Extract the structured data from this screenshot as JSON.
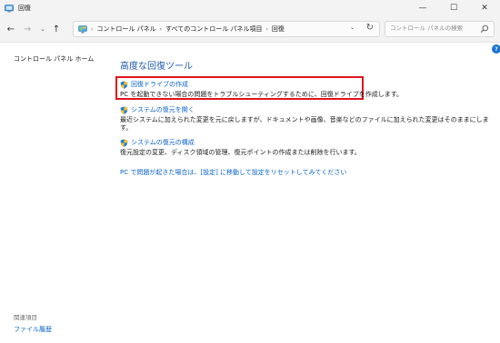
{
  "window": {
    "title": "回復",
    "minimize_glyph": "—",
    "maximize_glyph": "☐",
    "close_glyph": "✕"
  },
  "nav": {
    "back_glyph": "←",
    "forward_glyph": "→",
    "history_glyph": "⌄",
    "up_glyph": "↑",
    "refresh_glyph": "↻",
    "dropdown_glyph": "⌄"
  },
  "address": {
    "separator": "›",
    "breadcrumbs": [
      "コントロール パネル",
      "すべてのコントロール パネル項目",
      "回復"
    ]
  },
  "search": {
    "placeholder": "コントロール パネルの検索"
  },
  "help": {
    "label": "?"
  },
  "sidebar": {
    "home_label": "コントロール パネル ホーム",
    "related_heading": "関連項目",
    "related_links": [
      "ファイル履歴"
    ]
  },
  "main": {
    "title": "高度な回復ツール",
    "tasks": [
      {
        "link": "回復ドライブの作成",
        "description": "PC を起動できない場合の問題をトラブルシューティングするために、回復ドライブを作成します。"
      },
      {
        "link": "システムの復元を開く",
        "description": "最近システムに加えられた変更を元に戻しますが、ドキュメントや画像、音楽などのファイルに加えられた変更はそのままにしま\nす。"
      },
      {
        "link": "システムの復元の構成",
        "description": "復元設定の変更、ディスク領域の管理、復元ポイントの作成または削除を行います。"
      }
    ],
    "reset_link": "PC で問題が起きた場合は、[設定] に移動して設定をリセットしてみてください"
  },
  "colors": {
    "accent_link": "#0b63c9",
    "title_blue": "#1e5aa8",
    "highlight_red": "#e0141e",
    "chrome_bg": "#f3f3f3"
  },
  "icons": [
    "recovery-app-icon",
    "control-panel-icon",
    "search-icon",
    "uac-shield-icon",
    "help-icon"
  ]
}
